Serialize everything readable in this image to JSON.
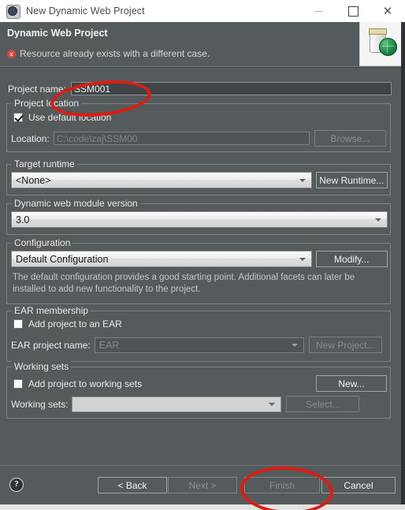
{
  "window": {
    "title": "New Dynamic Web Project",
    "app_icon": "eclipse-gear-icon",
    "minimize_label": "Minimize",
    "maximize_label": "Maximize",
    "close_label": "Close"
  },
  "header": {
    "title": "Dynamic Web Project",
    "message": "Resource already exists with a different case.",
    "message_type": "error",
    "error_glyph": "x",
    "banner_icon": "web-project-jar-globe-icon"
  },
  "form": {
    "project_name": {
      "label": "Project name:",
      "value": "SSM001"
    },
    "project_location": {
      "group_label": "Project location",
      "use_default_label": "Use default location",
      "use_default_checked": true,
      "location_label": "Location:",
      "location_value": "C:\\code\\zaj\\SSM00",
      "browse_label": "Browse...",
      "browse_enabled": false
    },
    "target_runtime": {
      "group_label": "Target runtime",
      "selected": "<None>",
      "new_runtime_label": "New Runtime..."
    },
    "module_version": {
      "group_label": "Dynamic web module version",
      "selected": "3.0"
    },
    "configuration": {
      "group_label": "Configuration",
      "selected": "Default Configuration",
      "modify_label": "Modify...",
      "description": "The default configuration provides a good starting point. Additional facets can later be installed to add new functionality to the project."
    },
    "ear_membership": {
      "group_label": "EAR membership",
      "add_to_ear_label": "Add project to an EAR",
      "add_to_ear_checked": false,
      "ear_project_name_label": "EAR project name:",
      "ear_project_name_value": "EAR",
      "new_project_label": "New Project...",
      "new_project_enabled": false
    },
    "working_sets": {
      "group_label": "Working sets",
      "add_to_working_sets_label": "Add project to working sets",
      "add_to_working_sets_checked": false,
      "working_sets_label": "Working sets:",
      "working_sets_value": "",
      "new_label": "New...",
      "select_label": "Select...",
      "select_enabled": false
    }
  },
  "footer": {
    "help_glyph": "?",
    "back_label": "< Back",
    "back_enabled": true,
    "next_label": "Next >",
    "next_enabled": false,
    "finish_label": "Finish",
    "finish_enabled": false,
    "cancel_label": "Cancel",
    "cancel_enabled": true
  },
  "annotations": {
    "color": "#e01b10",
    "marks": [
      {
        "name": "project-name-circle",
        "target": "project name field"
      },
      {
        "name": "finish-button-circle",
        "target": "Finish button"
      }
    ]
  }
}
